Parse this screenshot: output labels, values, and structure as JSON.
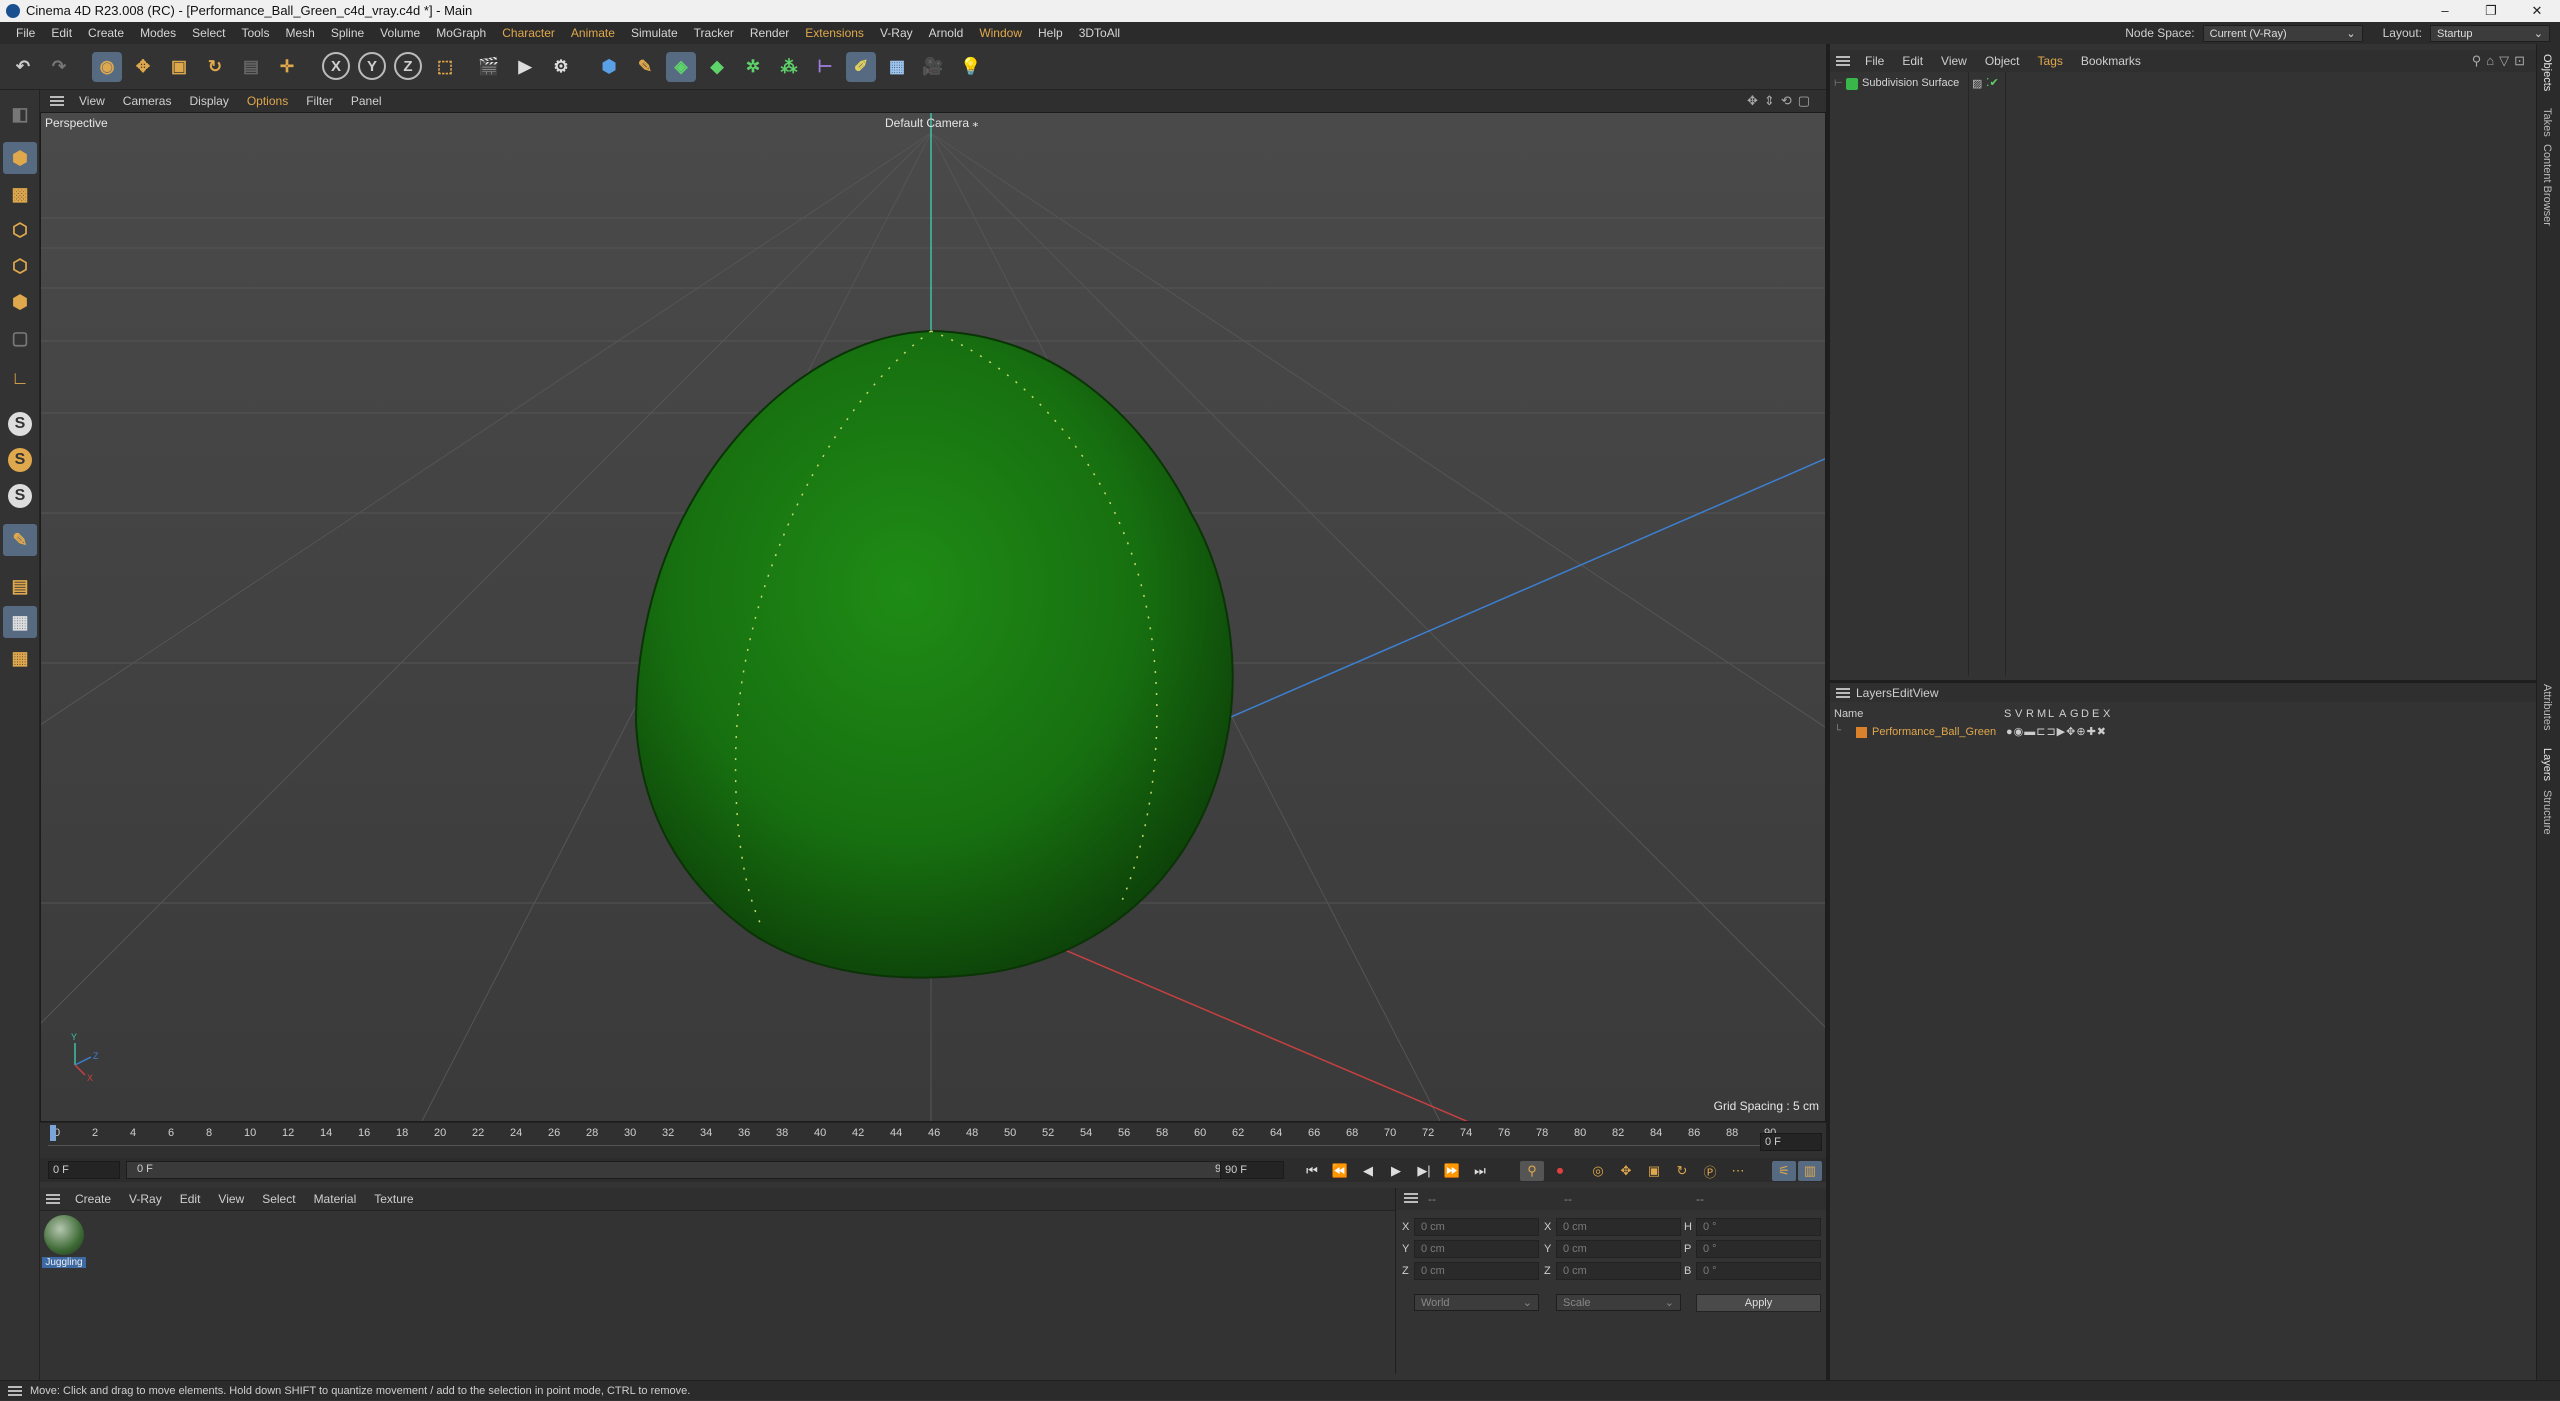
{
  "window": {
    "title": "Cinema 4D R23.008 (RC) - [Performance_Ball_Green_c4d_vray.c4d *] - Main",
    "controls": [
      "–",
      "❐",
      "✕"
    ]
  },
  "menubar": {
    "items": [
      "File",
      "Edit",
      "Create",
      "Modes",
      "Select",
      "Tools",
      "Mesh",
      "Spline",
      "Volume",
      "MoGraph",
      "Character",
      "Animate",
      "Simulate",
      "Tracker",
      "Render",
      "Extensions",
      "V-Ray",
      "Arnold",
      "Window",
      "Help",
      "3DToAll"
    ],
    "highlighted": [
      "Character",
      "Animate",
      "Extensions",
      "Window"
    ],
    "node_space_label": "Node Space:",
    "node_space_value": "Current (V-Ray)",
    "layout_label": "Layout:",
    "layout_value": "Startup"
  },
  "toolbar": {
    "axis_x": "X",
    "axis_y": "Y",
    "axis_z": "Z"
  },
  "lefttools": {
    "s1": "S",
    "s2": "S",
    "s3": "S"
  },
  "viewport": {
    "menu": [
      "View",
      "Cameras",
      "Display",
      "Options",
      "Filter",
      "Panel"
    ],
    "highlighted": "Options",
    "view_name": "Perspective",
    "camera": "Default Camera",
    "grid_spacing": "Grid Spacing : 5 cm",
    "axis_labels": {
      "x": "X",
      "y": "Y",
      "z": "Z"
    }
  },
  "timeline": {
    "ticks": [
      "0",
      "2",
      "4",
      "6",
      "8",
      "10",
      "12",
      "14",
      "16",
      "18",
      "20",
      "22",
      "24",
      "26",
      "28",
      "30",
      "32",
      "34",
      "36",
      "38",
      "40",
      "42",
      "44",
      "46",
      "48",
      "50",
      "52",
      "54",
      "56",
      "58",
      "60",
      "62",
      "64",
      "66",
      "68",
      "70",
      "72",
      "74",
      "76",
      "78",
      "80",
      "82",
      "84",
      "86",
      "88",
      "90"
    ],
    "current_frame_right": "0 F",
    "start_field": "0 F",
    "range_start": "0 F",
    "range_end": "90 F",
    "end_field": "90 F"
  },
  "materials": {
    "menu": [
      "Create",
      "V-Ray",
      "Edit",
      "View",
      "Select",
      "Material",
      "Texture"
    ],
    "items": [
      {
        "name": "Juggling"
      }
    ]
  },
  "coordinates": {
    "header_dashes": [
      "--",
      "--",
      "--"
    ],
    "rows": [
      {
        "a": "X",
        "a_val": "0 cm",
        "b": "X",
        "b_val": "0 cm",
        "c": "H",
        "c_val": "0 °"
      },
      {
        "a": "Y",
        "a_val": "0 cm",
        "b": "Y",
        "b_val": "0 cm",
        "c": "P",
        "c_val": "0 °"
      },
      {
        "a": "Z",
        "a_val": "0 cm",
        "b": "Z",
        "b_val": "0 cm",
        "c": "B",
        "c_val": "0 °"
      }
    ],
    "mode1": "World",
    "mode2": "Scale",
    "apply": "Apply"
  },
  "objects": {
    "menu": [
      "File",
      "Edit",
      "View",
      "Object",
      "Tags",
      "Bookmarks"
    ],
    "highlighted": "Tags",
    "items": [
      {
        "name": "Subdivision Surface"
      }
    ]
  },
  "layers": {
    "menu": [
      "Layers",
      "Edit",
      "View"
    ],
    "columns": [
      "Name",
      "S",
      "V",
      "R",
      "M",
      "L",
      "A",
      "G",
      "D",
      "E",
      "X"
    ],
    "items": [
      {
        "name": "Performance_Ball_Green",
        "color": "#d9822b"
      }
    ]
  },
  "side_tabs": [
    "Objects",
    "Takes",
    "Content Browser",
    "Attributes",
    "Layers",
    "Structure"
  ],
  "status": "Move: Click and drag to move elements. Hold down SHIFT to quantize movement / add to the selection in point mode, CTRL to remove.",
  "colors": {
    "accent": "#e0a84c",
    "ball": "#1a7d12",
    "bg": "#333333"
  }
}
